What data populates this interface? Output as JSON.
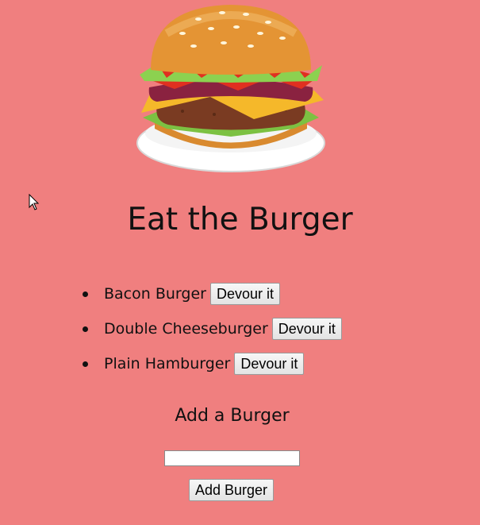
{
  "page": {
    "title": "Eat the Burger"
  },
  "logo": {
    "icon": "hamburger-icon"
  },
  "burgers": [
    {
      "name": "Bacon Burger",
      "button_label": "Devour it"
    },
    {
      "name": "Double Cheeseburger",
      "button_label": "Devour it"
    },
    {
      "name": "Plain Hamburger",
      "button_label": "Devour it"
    }
  ],
  "add_form": {
    "heading": "Add a Burger",
    "input_value": "",
    "button_label": "Add Burger"
  },
  "colors": {
    "background": "#f07f7f"
  }
}
